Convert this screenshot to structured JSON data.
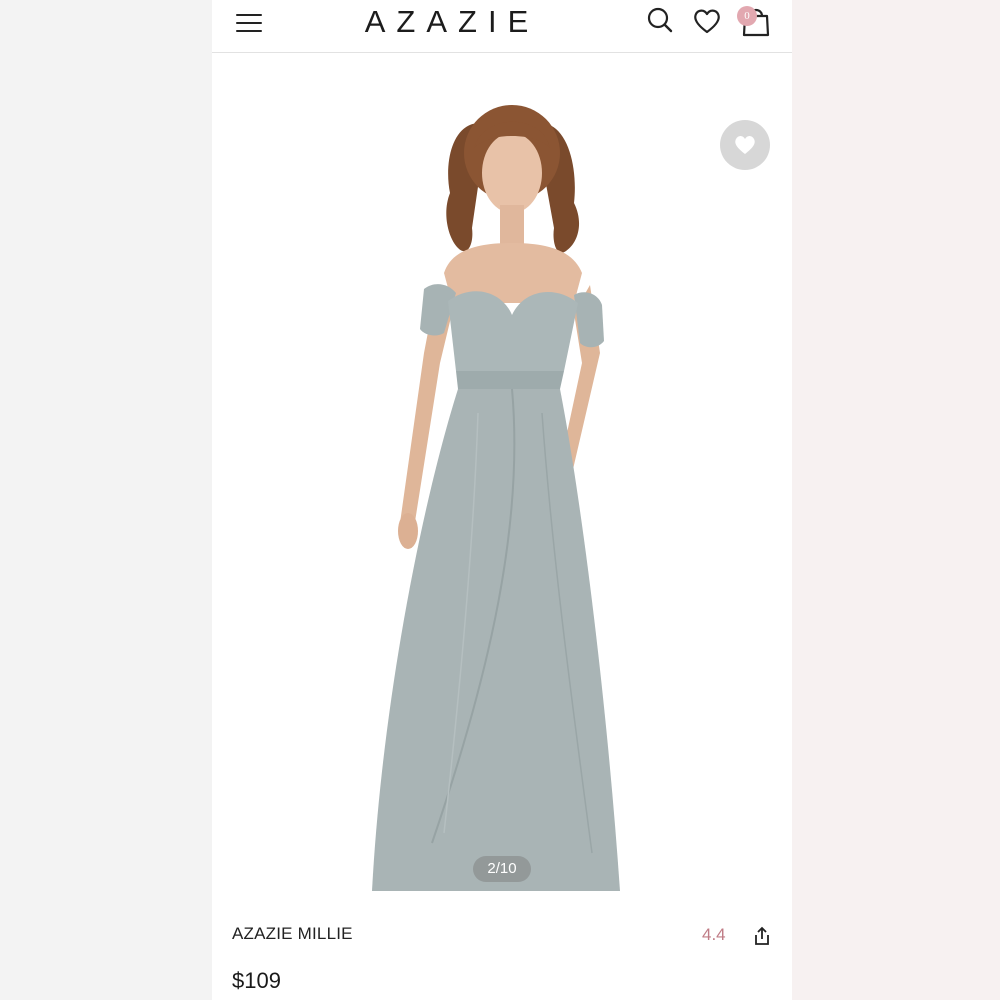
{
  "header": {
    "logo": "AZAZIE",
    "cart_count": "0",
    "icons": [
      "menu-icon",
      "search-icon",
      "heart-icon",
      "shopping-bag-icon"
    ]
  },
  "gallery": {
    "counter": "2/10",
    "favorite_icon": "heart-icon",
    "image_description_icon": "dress-photo"
  },
  "product": {
    "name": "AZAZIE MILLIE",
    "rating": "4.4",
    "price": "$109",
    "share_icon": "share-icon"
  },
  "colors": {
    "accent": "#c07c86",
    "badge": "#e2a8b0",
    "dress": "#a9b4b5"
  }
}
